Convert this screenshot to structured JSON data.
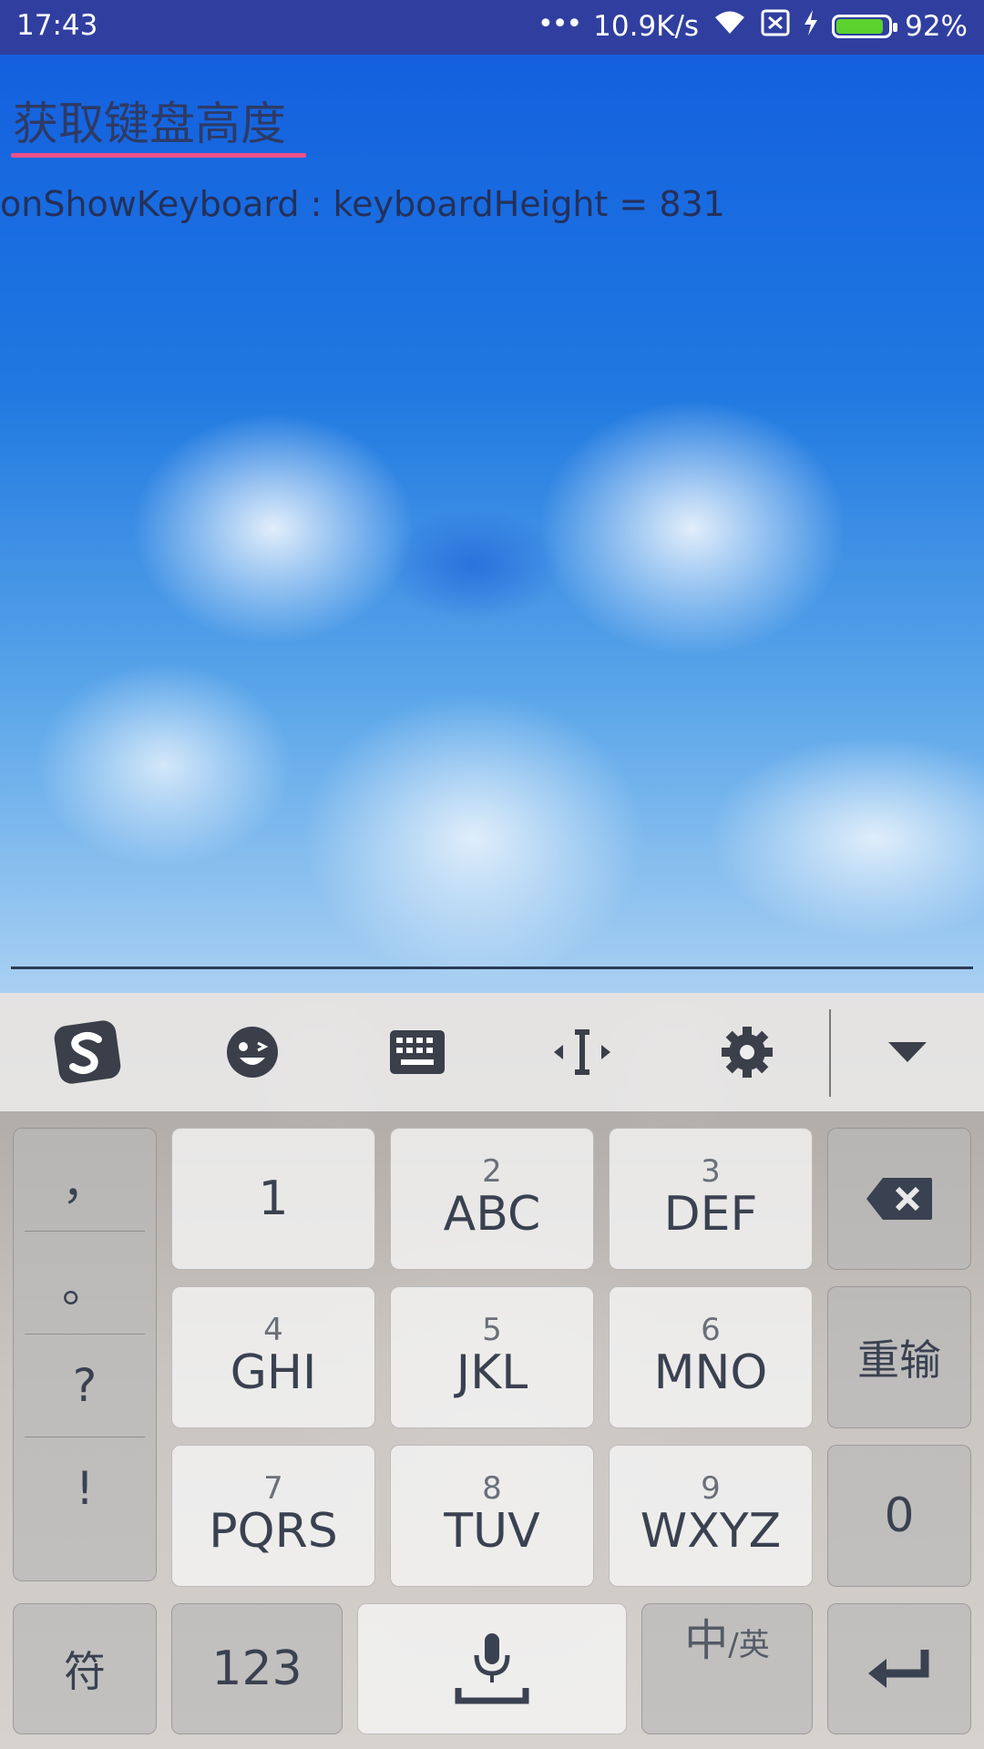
{
  "status_bar": {
    "time": "17:43",
    "network_speed": "10.9K/s",
    "battery_percent": "92%",
    "battery_level": 0.92,
    "icons": [
      "more-dots-icon",
      "wifi-icon",
      "sim-x-icon",
      "charging-icon",
      "battery-icon"
    ]
  },
  "page": {
    "title": "获取键盘高度",
    "info_text": "onShowKeyboard : keyboardHeight = 831"
  },
  "keyboard": {
    "toolbar": [
      "sogou-logo-icon",
      "emoji-icon",
      "keyboard-icon",
      "cursor-move-icon",
      "settings-icon",
      "collapse-chevron-icon"
    ],
    "punctuation": [
      "，",
      "。",
      "?",
      "!"
    ],
    "keys": {
      "k1": {
        "num": "",
        "label": "1"
      },
      "k2": {
        "num": "2",
        "label": "ABC"
      },
      "k3": {
        "num": "3",
        "label": "DEF"
      },
      "k4": {
        "num": "4",
        "label": "GHI"
      },
      "k5": {
        "num": "5",
        "label": "JKL"
      },
      "k6": {
        "num": "6",
        "label": "MNO"
      },
      "k7": {
        "num": "7",
        "label": "PQRS"
      },
      "k8": {
        "num": "8",
        "label": "TUV"
      },
      "k9": {
        "num": "9",
        "label": "WXYZ"
      }
    },
    "reinput_label": "重输",
    "zero_label": "0",
    "symbols_label": "符",
    "numbers_label": "123",
    "lang_main": "中",
    "lang_alt": "/英"
  },
  "colors": {
    "status_bar": "#303f9f",
    "title_underline": "#f0508a",
    "battery_fill": "#5bd22e"
  }
}
